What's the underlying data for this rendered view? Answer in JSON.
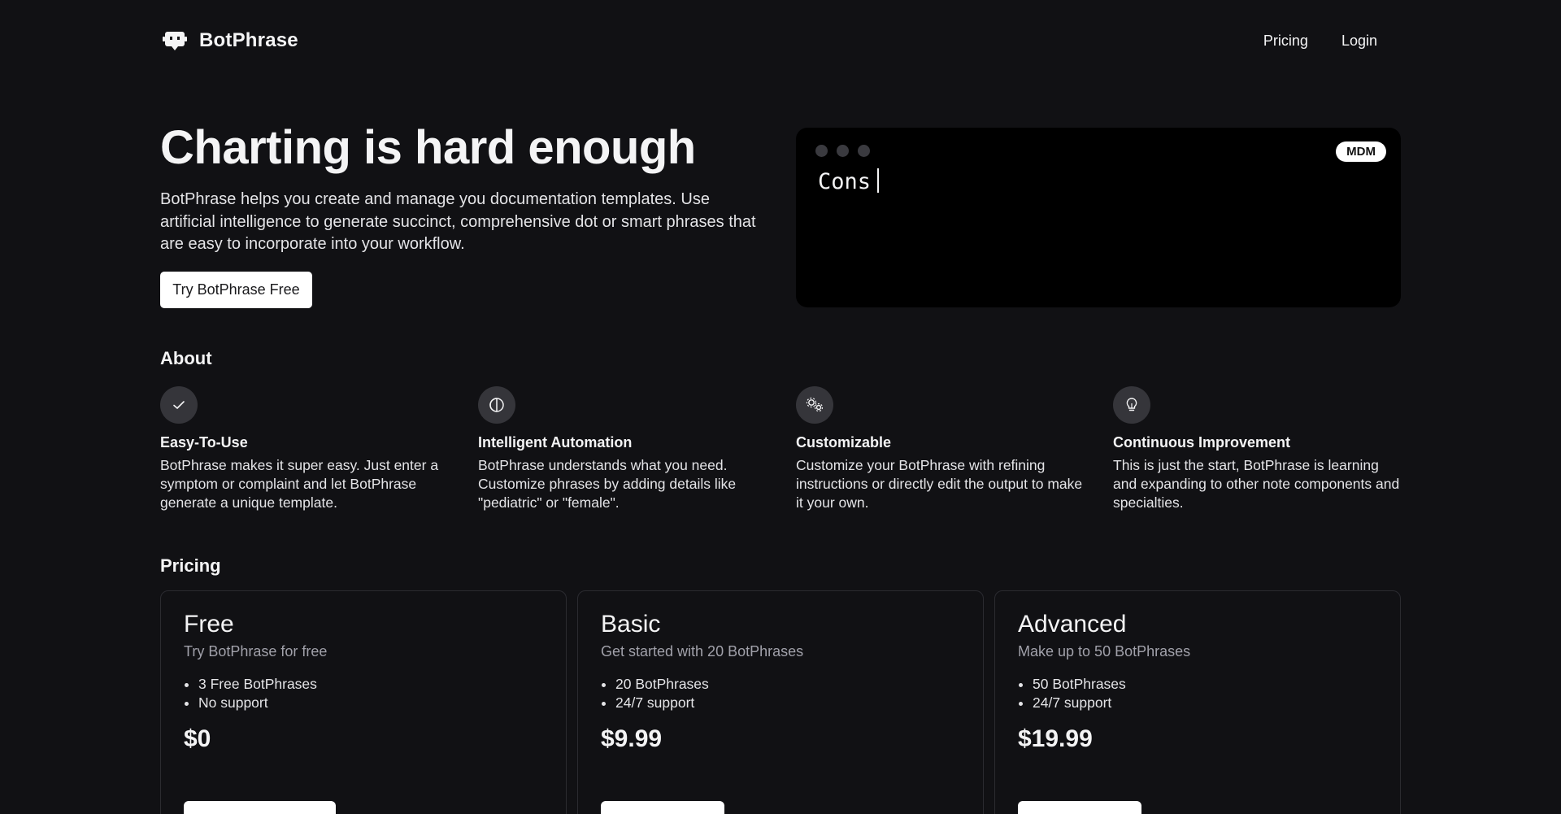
{
  "header": {
    "brand": "BotPhrase",
    "nav": {
      "pricing": "Pricing",
      "login": "Login"
    }
  },
  "hero": {
    "title": "Charting is hard enough",
    "description": "BotPhrase helps you create and manage you documentation templates. Use artificial intelligence to generate succinct, comprehensive dot or smart phrases that are easy to incorporate into your workflow.",
    "cta_label": "Try BotPhrase Free"
  },
  "terminal": {
    "badge": "MDM",
    "typed_text": "Cons"
  },
  "about": {
    "heading": "About",
    "features": [
      {
        "icon": "check-icon",
        "title": "Easy-To-Use",
        "description": "BotPhrase makes it super easy. Just enter a symptom or complaint and let BotPhrase generate a unique template."
      },
      {
        "icon": "half-circle-icon",
        "title": "Intelligent Automation",
        "description": "BotPhrase understands what you need. Customize phrases by adding details like \"pediatric\" or \"female\"."
      },
      {
        "icon": "gears-icon",
        "title": "Customizable",
        "description": "Customize your BotPhrase with refining instructions or directly edit the output to make it your own."
      },
      {
        "icon": "lightbulb-icon",
        "title": "Continuous Improvement",
        "description": "This is just the start, BotPhrase is learning and expanding to other note components and specialties."
      }
    ]
  },
  "pricing": {
    "heading": "Pricing",
    "plans": [
      {
        "name": "Free",
        "subtitle": "Try BotPhrase for free",
        "features": [
          "3 Free BotPhrases",
          "No support"
        ],
        "price": "$0"
      },
      {
        "name": "Basic",
        "subtitle": "Get started with 20 BotPhrases",
        "features": [
          "20 BotPhrases",
          "24/7 support"
        ],
        "price": "$9.99"
      },
      {
        "name": "Advanced",
        "subtitle": "Make up to 50 BotPhrases",
        "features": [
          "50 BotPhrases",
          "24/7 support"
        ],
        "price": "$19.99"
      }
    ]
  },
  "colors": {
    "background": "#111114",
    "text": "#f4f4f5",
    "muted": "#a1a1aa",
    "terminal_bg": "#000000",
    "icon_circle": "#35353a"
  }
}
